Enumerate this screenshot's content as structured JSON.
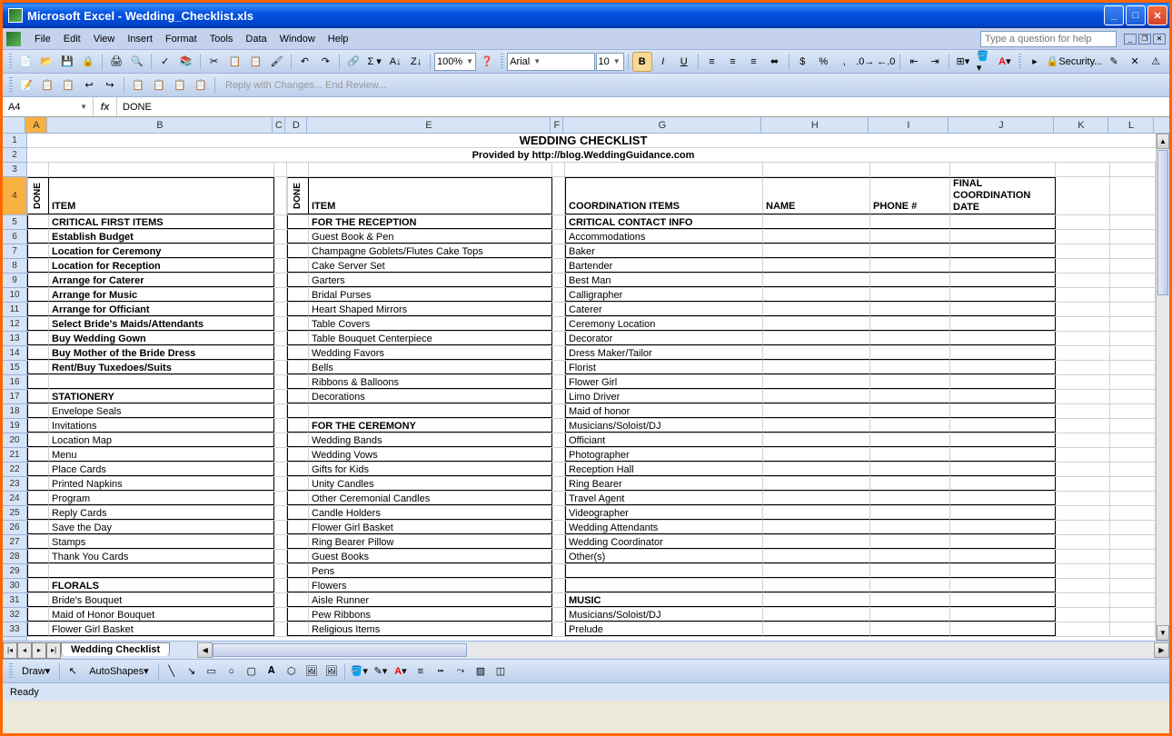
{
  "window": {
    "app": "Microsoft Excel",
    "file": "Wedding_Checklist.xls"
  },
  "menu": [
    "File",
    "Edit",
    "View",
    "Insert",
    "Format",
    "Tools",
    "Data",
    "Window",
    "Help"
  ],
  "help_placeholder": "Type a question for help",
  "toolbar1": {
    "zoom": "100%",
    "font": "Arial",
    "size": "10",
    "security": "Security..."
  },
  "namebox": "A4",
  "formula": "DONE",
  "columns": [
    "A",
    "B",
    "C",
    "D",
    "E",
    "F",
    "G",
    "H",
    "I",
    "J",
    "K",
    "L"
  ],
  "title": "WEDDING CHECKLIST",
  "subtitle": "Provided by http://blog.WeddingGuidance.com",
  "headers": {
    "done1": "DONE",
    "item1": "ITEM",
    "done2": "DONE",
    "item2": "ITEM",
    "coord": "COORDINATION ITEMS",
    "name": "NAME",
    "phone": "PHONE #",
    "final": "FINAL COORDINATION DATE"
  },
  "colB": [
    {
      "t": "CRITICAL FIRST ITEMS",
      "b": 1
    },
    {
      "t": "Establish Budget",
      "b": 1
    },
    {
      "t": "Location for Ceremony",
      "b": 1
    },
    {
      "t": "Location for Reception",
      "b": 1
    },
    {
      "t": "Arrange for Caterer",
      "b": 1
    },
    {
      "t": "Arrange for Music",
      "b": 1
    },
    {
      "t": "Arrange for Officiant",
      "b": 1
    },
    {
      "t": "Select Bride's Maids/Attendants",
      "b": 1
    },
    {
      "t": "Buy Wedding Gown",
      "b": 1
    },
    {
      "t": "Buy Mother of the Bride Dress",
      "b": 1
    },
    {
      "t": "Rent/Buy Tuxedoes/Suits",
      "b": 1
    },
    {
      "t": "",
      "b": 0
    },
    {
      "t": " STATIONERY",
      "b": 1
    },
    {
      "t": "Envelope Seals",
      "b": 0
    },
    {
      "t": "Invitations",
      "b": 0
    },
    {
      "t": "Location Map",
      "b": 0
    },
    {
      "t": "Menu",
      "b": 0
    },
    {
      "t": "Place Cards",
      "b": 0
    },
    {
      "t": "Printed Napkins",
      "b": 0
    },
    {
      "t": "Program",
      "b": 0
    },
    {
      "t": "Reply Cards",
      "b": 0
    },
    {
      "t": "Save the Day",
      "b": 0
    },
    {
      "t": "Stamps",
      "b": 0
    },
    {
      "t": "Thank You Cards",
      "b": 0
    },
    {
      "t": "",
      "b": 0
    },
    {
      "t": "FLORALS",
      "b": 1
    },
    {
      "t": "Bride's Bouquet",
      "b": 0
    },
    {
      "t": "Maid of Honor Bouquet",
      "b": 0
    },
    {
      "t": "Flower Girl Basket",
      "b": 0
    }
  ],
  "colE": [
    {
      "t": "FOR THE RECEPTION",
      "b": 1
    },
    {
      "t": "Guest Book & Pen",
      "b": 0
    },
    {
      "t": "Champagne Goblets/Flutes Cake Tops",
      "b": 0
    },
    {
      "t": "Cake Server Set",
      "b": 0
    },
    {
      "t": "Garters",
      "b": 0
    },
    {
      "t": "Bridal Purses",
      "b": 0
    },
    {
      "t": "Heart Shaped Mirrors",
      "b": 0
    },
    {
      "t": "Table Covers",
      "b": 0
    },
    {
      "t": "Table Bouquet Centerpiece",
      "b": 0
    },
    {
      "t": "Wedding Favors",
      "b": 0
    },
    {
      "t": "Bells",
      "b": 0
    },
    {
      "t": "Ribbons & Balloons",
      "b": 0
    },
    {
      "t": "Decorations",
      "b": 0
    },
    {
      "t": "",
      "b": 0
    },
    {
      "t": "FOR THE CEREMONY",
      "b": 1
    },
    {
      "t": "Wedding Bands",
      "b": 0
    },
    {
      "t": "Wedding Vows",
      "b": 0
    },
    {
      "t": "Gifts for Kids",
      "b": 0
    },
    {
      "t": "Unity Candles",
      "b": 0
    },
    {
      "t": "Other Ceremonial Candles",
      "b": 0
    },
    {
      "t": "Candle Holders",
      "b": 0
    },
    {
      "t": "Flower Girl Basket",
      "b": 0
    },
    {
      "t": "Ring Bearer Pillow",
      "b": 0
    },
    {
      "t": "Guest Books",
      "b": 0
    },
    {
      "t": "Pens",
      "b": 0
    },
    {
      "t": "Flowers",
      "b": 0
    },
    {
      "t": "Aisle Runner",
      "b": 0
    },
    {
      "t": "Pew Ribbons",
      "b": 0
    },
    {
      "t": "Religious Items",
      "b": 0
    }
  ],
  "colG": [
    {
      "t": "CRITICAL CONTACT INFO",
      "b": 1
    },
    {
      "t": "Accommodations",
      "b": 0
    },
    {
      "t": "Baker",
      "b": 0
    },
    {
      "t": "Bartender",
      "b": 0
    },
    {
      "t": "Best Man",
      "b": 0
    },
    {
      "t": "Calligrapher",
      "b": 0
    },
    {
      "t": "Caterer",
      "b": 0
    },
    {
      "t": "Ceremony Location",
      "b": 0
    },
    {
      "t": "Decorator",
      "b": 0
    },
    {
      "t": "Dress Maker/Tailor",
      "b": 0
    },
    {
      "t": "Florist",
      "b": 0
    },
    {
      "t": "Flower Girl",
      "b": 0
    },
    {
      "t": "Limo Driver",
      "b": 0
    },
    {
      "t": "Maid of honor",
      "b": 0
    },
    {
      "t": "Musicians/Soloist/DJ",
      "b": 0
    },
    {
      "t": "Officiant",
      "b": 0
    },
    {
      "t": "Photographer",
      "b": 0
    },
    {
      "t": "Reception Hall",
      "b": 0
    },
    {
      "t": "Ring Bearer",
      "b": 0
    },
    {
      "t": "Travel Agent",
      "b": 0
    },
    {
      "t": "Videographer",
      "b": 0
    },
    {
      "t": "Wedding Attendants",
      "b": 0
    },
    {
      "t": "Wedding Coordinator",
      "b": 0
    },
    {
      "t": "Other(s)",
      "b": 0
    },
    {
      "t": "",
      "b": 0
    },
    {
      "t": "",
      "b": 0
    },
    {
      "t": "MUSIC",
      "b": 1
    },
    {
      "t": "Musicians/Soloist/DJ",
      "b": 0
    },
    {
      "t": "Prelude",
      "b": 0
    }
  ],
  "sheet_tab": "Wedding Checklist",
  "draw_label": "Draw",
  "autoshapes": "AutoShapes",
  "status": "Ready"
}
